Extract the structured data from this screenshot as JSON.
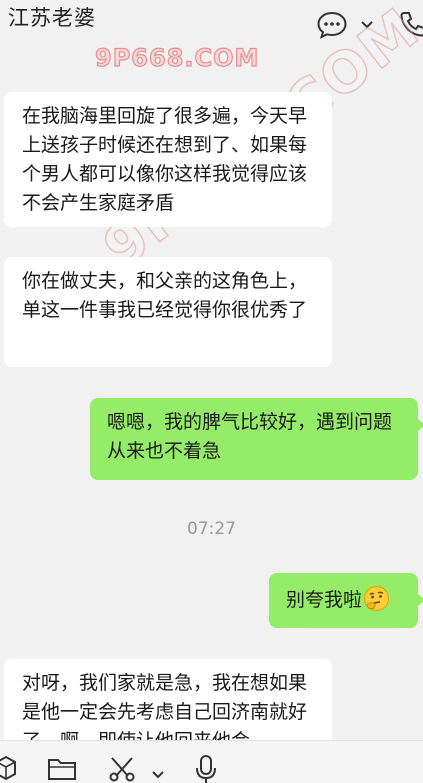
{
  "header": {
    "title": "江苏老婆",
    "icons": [
      "chat-bubble-icon",
      "chevron-down-icon",
      "phone-icon"
    ]
  },
  "watermark": {
    "top_text": "9P668.COM",
    "diagonal_text": "9P668.COM"
  },
  "messages": [
    {
      "side": "left",
      "text": "在我脑海里回旋了很多遍，今天早上送孩子时候还在想到了、如果每个男人都可以像你这样我觉得应该不会产生家庭矛盾"
    },
    {
      "side": "left",
      "text": "你在做丈夫，和父亲的这角色上，单这一件事我已经觉得你很优秀了"
    },
    {
      "side": "right",
      "text": "嗯嗯，我的脾气比较好，遇到问题从来也不着急"
    },
    {
      "side": "right",
      "text": "别夸我啦",
      "emoji": "thinking-face-icon"
    },
    {
      "side": "left",
      "text": "对呀，我们家就是急，我在想如果是他一定会先考虑自己回济南就好了，啊，即使让他回来他会"
    }
  ],
  "timestamp": "07:27",
  "toolbar": {
    "icons": [
      "sticker-icon",
      "folder-icon",
      "scissors-icon",
      "chevron-down-icon",
      "microphone-icon"
    ]
  },
  "colors": {
    "background": "#f1f1f1",
    "incoming_bubble": "#ffffff",
    "outgoing_bubble": "#95ec69",
    "watermark": "#e58f8f"
  }
}
